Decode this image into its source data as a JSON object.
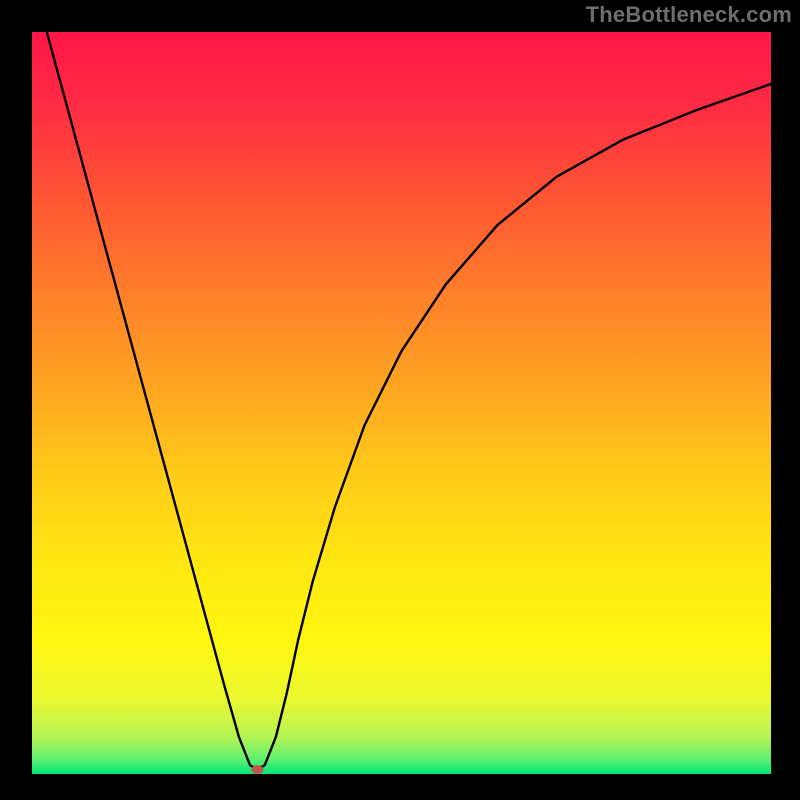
{
  "attribution": "TheBottleneck.com",
  "chart_data": {
    "type": "line",
    "title": "",
    "xlabel": "",
    "ylabel": "",
    "xlim": [
      0,
      100
    ],
    "ylim": [
      0,
      100
    ],
    "grid": false,
    "legend": false,
    "background": {
      "top_color": "#ff1a4d",
      "mid_color": "#ffe400",
      "bottom_color": "#00e874",
      "note": "vertical gradient red→orange→yellow→green"
    },
    "series": [
      {
        "name": "curve",
        "color": "#000000",
        "x": [
          2,
          5,
          8,
          11,
          14,
          17,
          20,
          23,
          26,
          28,
          29.5,
          30.5,
          31.5,
          33,
          34.5,
          36,
          38,
          41,
          45,
          50,
          56,
          63,
          71,
          80,
          90,
          100
        ],
        "y": [
          100,
          89,
          78,
          67,
          56,
          45,
          34,
          23,
          12,
          5,
          1.2,
          0.6,
          1.2,
          5,
          11,
          18,
          26,
          36,
          47,
          57,
          66,
          74,
          80.5,
          85.5,
          89.5,
          93
        ]
      }
    ],
    "marker": {
      "name": "min-point",
      "x": 30.5,
      "y": 0.6,
      "color": "#c2564a",
      "rx": 6,
      "ry": 4.5
    }
  }
}
